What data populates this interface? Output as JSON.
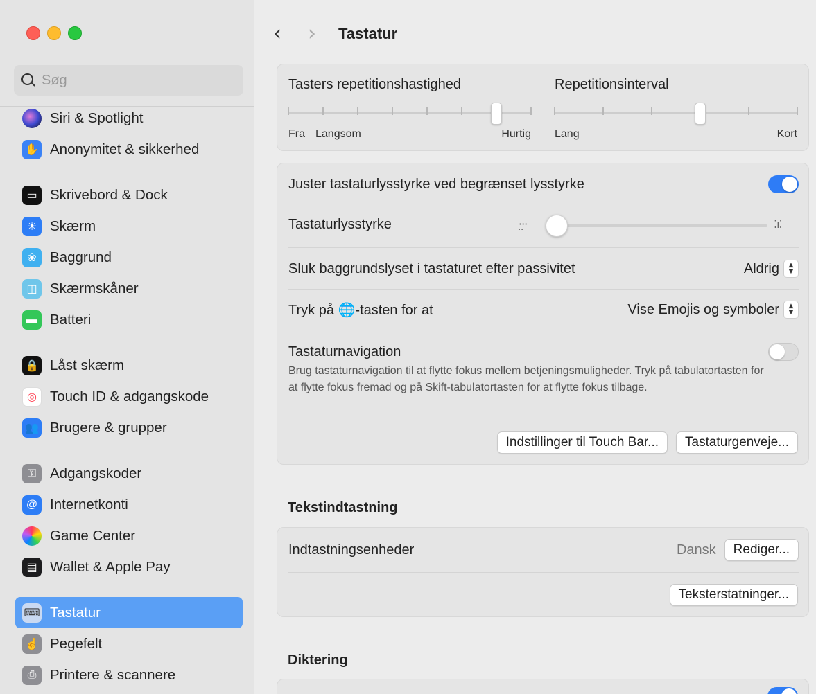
{
  "window": {
    "title": "Tastatur"
  },
  "search": {
    "placeholder": "Søg"
  },
  "sidebar": {
    "items": [
      {
        "label": "Siri & Spotlight",
        "icon": "siri-icon"
      },
      {
        "label": "Anonymitet & sikkerhed",
        "icon": "privacy-hand-icon"
      },
      {
        "label": "Skrivebord & Dock",
        "icon": "desktop-dock-icon"
      },
      {
        "label": "Skærm",
        "icon": "display-sun-icon"
      },
      {
        "label": "Baggrund",
        "icon": "wallpaper-flower-icon"
      },
      {
        "label": "Skærmskåner",
        "icon": "screensaver-icon"
      },
      {
        "label": "Batteri",
        "icon": "battery-icon"
      },
      {
        "label": "Låst skærm",
        "icon": "lock-icon"
      },
      {
        "label": "Touch ID & adgangskode",
        "icon": "fingerprint-icon"
      },
      {
        "label": "Brugere & grupper",
        "icon": "users-icon"
      },
      {
        "label": "Adgangskoder",
        "icon": "key-icon"
      },
      {
        "label": "Internetkonti",
        "icon": "at-icon"
      },
      {
        "label": "Game Center",
        "icon": "game-center-icon"
      },
      {
        "label": "Wallet & Apple Pay",
        "icon": "wallet-icon"
      },
      {
        "label": "Tastatur",
        "icon": "keyboard-icon",
        "active": true
      },
      {
        "label": "Pegefelt",
        "icon": "trackpad-icon"
      },
      {
        "label": "Printere & scannere",
        "icon": "printer-icon"
      }
    ]
  },
  "repeat": {
    "rate_title": "Tasters repetitionshastighed",
    "rate_min_off": "Fra",
    "rate_min": "Langsom",
    "rate_max": "Hurtig",
    "delay_title": "Repetitionsinterval",
    "delay_min": "Lang",
    "delay_max": "Kort",
    "rate_level": 7,
    "rate_levels": 8,
    "delay_level": 4,
    "delay_levels": 6
  },
  "settings": {
    "auto_brightness_label": "Juster tastaturlysstyrke ved begrænset lysstyrke",
    "auto_brightness_on": true,
    "brightness_label": "Tastaturlysstyrke",
    "brightness_value": 0.0,
    "backlight_off_label": "Sluk baggrundslyset i tastaturet efter passivitet",
    "backlight_off_value": "Aldrig",
    "globe_label_pre": "Tryk på",
    "globe_label_post": "-tasten for at",
    "globe_value": "Vise Emojis og symboler",
    "nav_label": "Tastaturnavigation",
    "nav_on": false,
    "nav_desc": "Brug tastaturnavigation til at flytte fokus mellem betjeningsmuligheder. Tryk på tabulatortasten for at flytte fokus fremad og på Skift-tabulatortasten for at flytte fokus tilbage.",
    "touchbar_button": "Indstillinger til Touch Bar...",
    "shortcuts_button": "Tastaturgenveje..."
  },
  "text_input": {
    "heading": "Tekstindtastning",
    "sources_label": "Indtastningsenheder",
    "sources_value": "Dansk",
    "edit_button": "Rediger...",
    "replacements_button": "Teksterstatninger..."
  },
  "dictation": {
    "heading": "Diktering"
  },
  "colors": {
    "accent": "#2e7cf6",
    "sidebar_selected": "#5a9ff5"
  }
}
